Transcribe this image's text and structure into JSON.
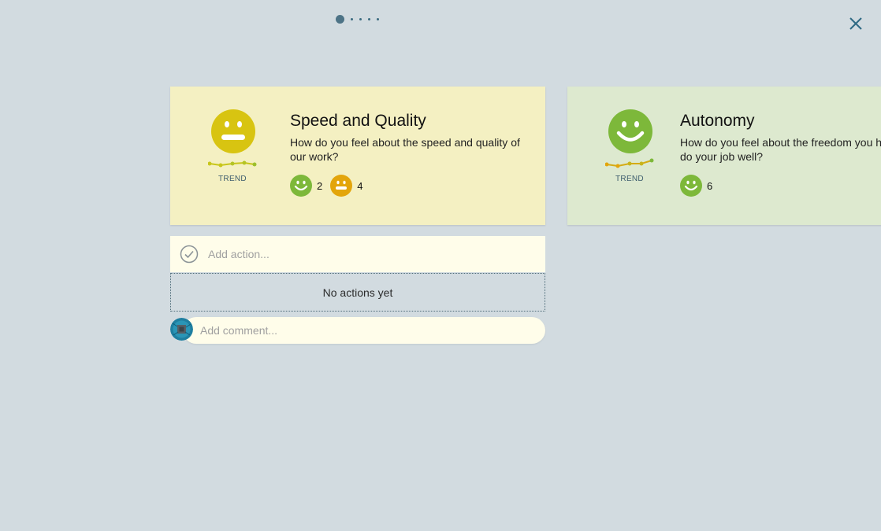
{
  "pager": {
    "total": 5,
    "active_index": 0
  },
  "colors": {
    "background": "#d2dbe0",
    "yellow_card": "#f4f0c2",
    "green_card": "#dde9cf",
    "happy_yellow": "#d8c411",
    "happy_green": "#7db83a",
    "neutral_orange": "#e3a50b",
    "close_icon": "#2f6a84"
  },
  "cards": [
    {
      "face_icon": "smiley-yellow-icon",
      "trend_label": "TREND",
      "title": "Speed and Quality",
      "question": "How do you feel about the speed and quality of our work?",
      "votes": [
        {
          "icon": "happy-green-icon",
          "count": "2"
        },
        {
          "icon": "neutral-orange-icon",
          "count": "4"
        }
      ]
    },
    {
      "face_icon": "smiley-green-icon",
      "trend_label": "TREND",
      "title": "Autonomy",
      "question": "How do you feel about the freedom you have to do your job well?",
      "votes": [
        {
          "icon": "happy-green-icon",
          "count": "6"
        }
      ]
    }
  ],
  "actions": {
    "placeholder": "Add action...",
    "empty_text": "No actions yet"
  },
  "comment": {
    "placeholder": "Add comment..."
  }
}
